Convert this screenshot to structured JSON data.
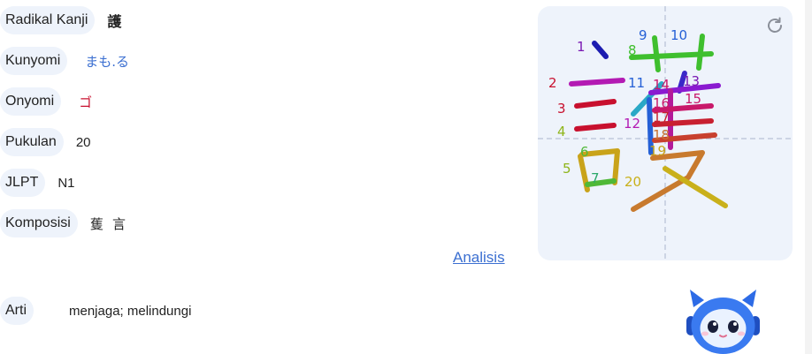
{
  "details": {
    "radikal": {
      "label": "Radikal Kanji",
      "value": "護"
    },
    "kunyomi": {
      "label": "Kunyomi",
      "value": "まも.る"
    },
    "onyomi": {
      "label": "Onyomi",
      "value": "ゴ"
    },
    "pukulan": {
      "label": "Pukulan",
      "value": "20"
    },
    "jlpt": {
      "label": "JLPT",
      "value": "N1"
    },
    "komposisi": {
      "label": "Komposisi",
      "parts": [
        "蒦",
        "言"
      ]
    }
  },
  "analisis_link": "Analisis",
  "arti": {
    "label": "Arti",
    "value": "menjaga; melindungi"
  },
  "stroke_panel": {
    "kanji": "護",
    "stroke_numbers": [
      "1",
      "2",
      "3",
      "4",
      "5",
      "6",
      "7",
      "8",
      "9",
      "10",
      "11",
      "12",
      "13",
      "14",
      "15",
      "16",
      "17",
      "18",
      "19",
      "20"
    ],
    "reload_icon": "reload-icon"
  },
  "colors": {
    "accent": "#3b6fd1",
    "onyomi": "#c8102e",
    "pill_bg": "#eef3fb"
  }
}
